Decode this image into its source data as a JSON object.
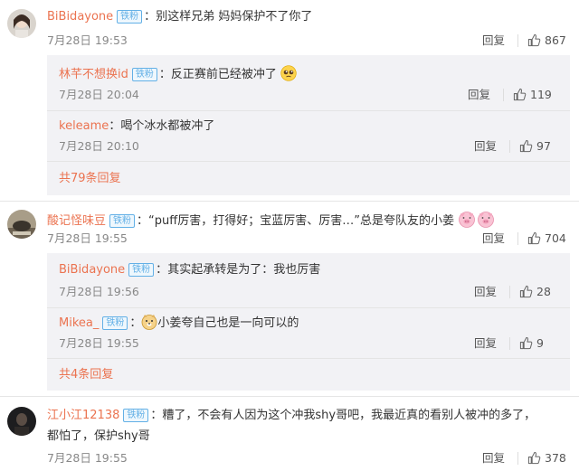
{
  "labels": {
    "reply": "回复",
    "fan_badge": "铁粉"
  },
  "comments": [
    {
      "user": "BiBidayone",
      "text": "别这样兄弟 妈妈保护不了你了",
      "time": "7月28日 19:53",
      "likes": "867",
      "replies": [
        {
          "user": "林芊不想换id",
          "text": "反正赛前已经被冲了",
          "time": "7月28日 20:04",
          "likes": "119",
          "emoji": "pleading-face"
        },
        {
          "user": "keleame",
          "text": "喝个冰水都被冲了",
          "time": "7月28日 20:10",
          "likes": "97"
        }
      ],
      "more": "共79条回复"
    },
    {
      "user": "酸记怪味豆",
      "text": "“puff厉害，打得好；宝蓝厉害、厉害…”总是夸队友的小姜",
      "time": "7月28日 19:55",
      "likes": "704",
      "emoji": "pig-faces",
      "replies": [
        {
          "user": "BiBidayone",
          "text": "其实起承转是为了：我也厉害",
          "time": "7月28日 19:56",
          "likes": "28"
        },
        {
          "user": "Mikea_",
          "text": "小姜夸自己也是一向可以的",
          "time": "7月28日 19:55",
          "likes": "9",
          "emoji": "doge"
        }
      ],
      "more": "共4条回复"
    },
    {
      "user": "江小江12138",
      "text": "糟了，不会有人因为这个冲我shy哥吧，我最近真的看别人被冲的多了，",
      "text2": "都怕了，保护shy哥",
      "time": "7月28日 19:55",
      "likes": "378"
    }
  ]
}
